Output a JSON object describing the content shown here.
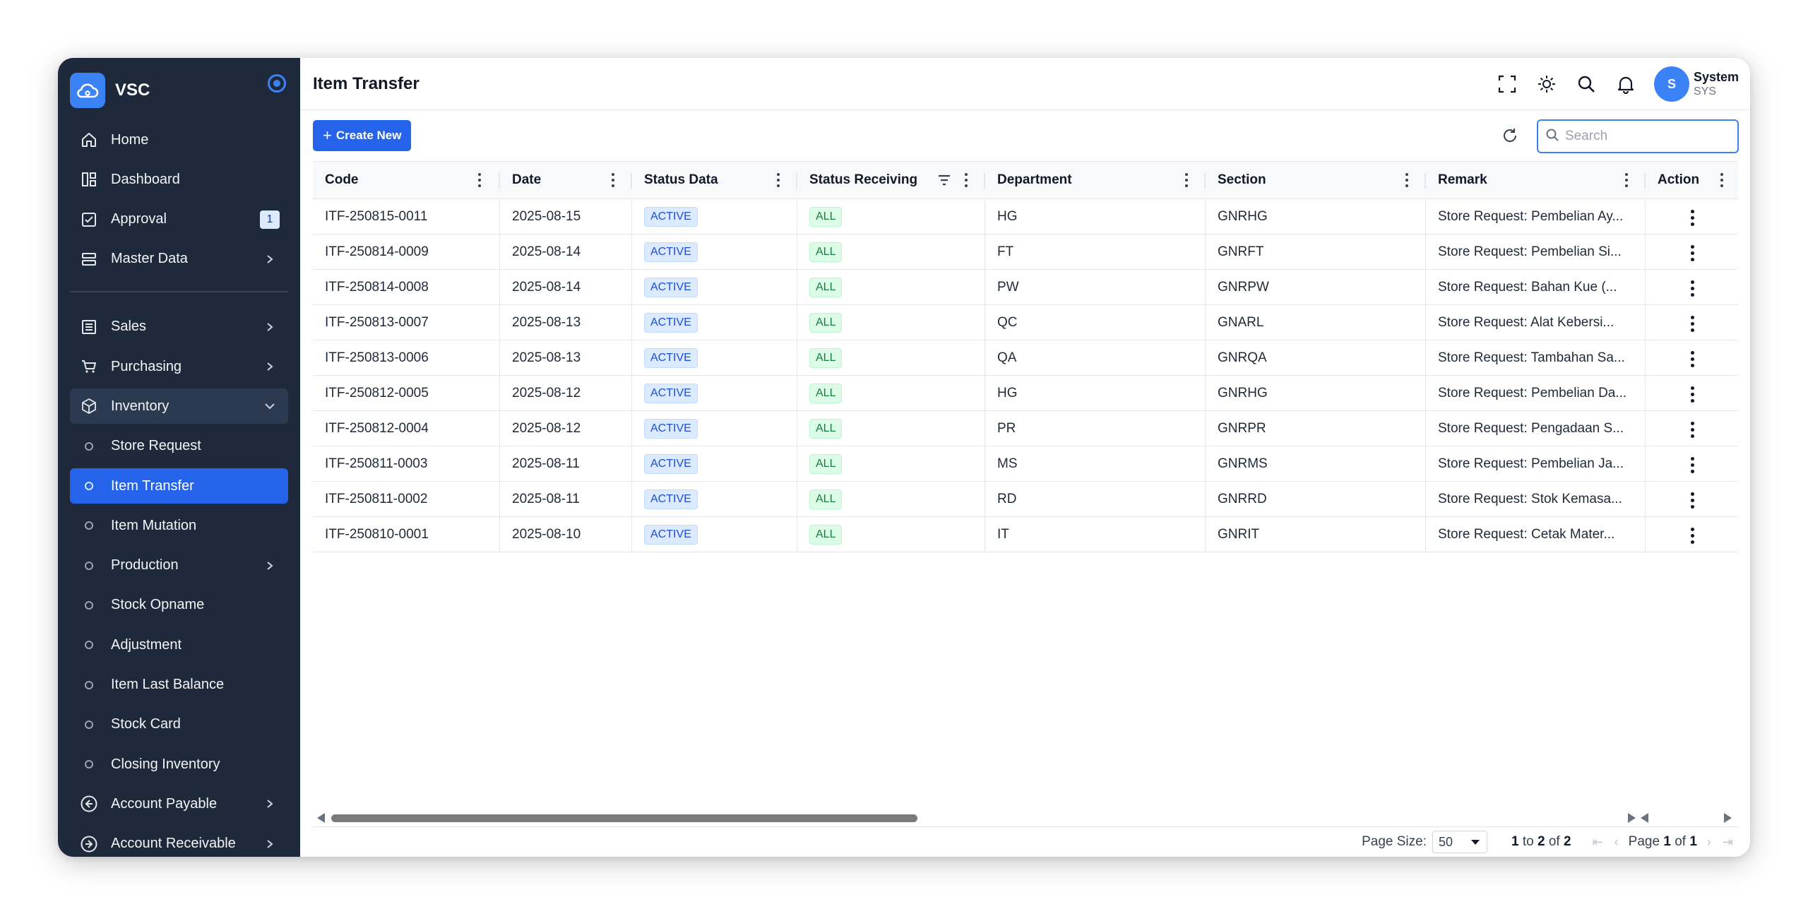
{
  "app": {
    "name": "VSC"
  },
  "sidebar": {
    "items": [
      {
        "label": "Home",
        "icon": "home-icon"
      },
      {
        "label": "Dashboard",
        "icon": "dashboard-icon"
      },
      {
        "label": "Approval",
        "icon": "approval-icon",
        "badge": "1"
      },
      {
        "label": "Master Data",
        "icon": "database-icon"
      },
      {
        "label": "Sales",
        "icon": "sales-icon"
      },
      {
        "label": "Purchasing",
        "icon": "cart-icon"
      },
      {
        "label": "Inventory",
        "icon": "box-icon"
      },
      {
        "label": "Store Request"
      },
      {
        "label": "Item Transfer"
      },
      {
        "label": "Item Mutation"
      },
      {
        "label": "Production"
      },
      {
        "label": "Stock Opname"
      },
      {
        "label": "Adjustment"
      },
      {
        "label": "Item Last Balance"
      },
      {
        "label": "Stock Card"
      },
      {
        "label": "Closing Inventory"
      },
      {
        "label": "Account Payable",
        "icon": "arrow-left-circle-icon"
      },
      {
        "label": "Account Receivable",
        "icon": "arrow-right-circle-icon"
      }
    ]
  },
  "header": {
    "title": "Item Transfer",
    "user": {
      "initial": "S",
      "name": "System",
      "code": "SYS"
    }
  },
  "toolbar": {
    "create_label": "Create New",
    "search_placeholder": "Search"
  },
  "table": {
    "columns": [
      "Code",
      "Date",
      "Status Data",
      "Status Receiving",
      "Department",
      "Section",
      "Remark",
      "Action"
    ],
    "rows": [
      {
        "code": "ITF-250815-0011",
        "date": "2025-08-15",
        "status_data": "ACTIVE",
        "status_receiving": "ALL",
        "department": "HG",
        "section": "GNRHG",
        "remark": "Store Request: Pembelian Ay..."
      },
      {
        "code": "ITF-250814-0009",
        "date": "2025-08-14",
        "status_data": "ACTIVE",
        "status_receiving": "ALL",
        "department": "FT",
        "section": "GNRFT",
        "remark": "Store Request: Pembelian Si..."
      },
      {
        "code": "ITF-250814-0008",
        "date": "2025-08-14",
        "status_data": "ACTIVE",
        "status_receiving": "ALL",
        "department": "PW",
        "section": "GNRPW",
        "remark": "Store Request: Bahan Kue (..."
      },
      {
        "code": "ITF-250813-0007",
        "date": "2025-08-13",
        "status_data": "ACTIVE",
        "status_receiving": "ALL",
        "department": "QC",
        "section": "GNARL",
        "remark": "Store Request: Alat Kebersi..."
      },
      {
        "code": "ITF-250813-0006",
        "date": "2025-08-13",
        "status_data": "ACTIVE",
        "status_receiving": "ALL",
        "department": "QA",
        "section": "GNRQA",
        "remark": "Store Request: Tambahan Sa..."
      },
      {
        "code": "ITF-250812-0005",
        "date": "2025-08-12",
        "status_data": "ACTIVE",
        "status_receiving": "ALL",
        "department": "HG",
        "section": "GNRHG",
        "remark": "Store Request: Pembelian Da..."
      },
      {
        "code": "ITF-250812-0004",
        "date": "2025-08-12",
        "status_data": "ACTIVE",
        "status_receiving": "ALL",
        "department": "PR",
        "section": "GNRPR",
        "remark": "Store Request: Pengadaan S..."
      },
      {
        "code": "ITF-250811-0003",
        "date": "2025-08-11",
        "status_data": "ACTIVE",
        "status_receiving": "ALL",
        "department": "MS",
        "section": "GNRMS",
        "remark": "Store Request: Pembelian Ja..."
      },
      {
        "code": "ITF-250811-0002",
        "date": "2025-08-11",
        "status_data": "ACTIVE",
        "status_receiving": "ALL",
        "department": "RD",
        "section": "GNRRD",
        "remark": "Store Request: Stok Kemasa..."
      },
      {
        "code": "ITF-250810-0001",
        "date": "2025-08-10",
        "status_data": "ACTIVE",
        "status_receiving": "ALL",
        "department": "IT",
        "section": "GNRIT",
        "remark": "Store Request: Cetak Mater..."
      }
    ]
  },
  "pagination": {
    "page_size_label": "Page Size:",
    "page_size": "50",
    "from": "1",
    "to_label": "to",
    "to": "2",
    "of_label": "of",
    "total": "2",
    "page_label": "Page",
    "page": "1",
    "pages": "1"
  },
  "colors": {
    "primary": "#2563eb",
    "sidebar": "#1e2a3b",
    "active_tag": "#dbeafe",
    "all_tag": "#dcfce7"
  }
}
